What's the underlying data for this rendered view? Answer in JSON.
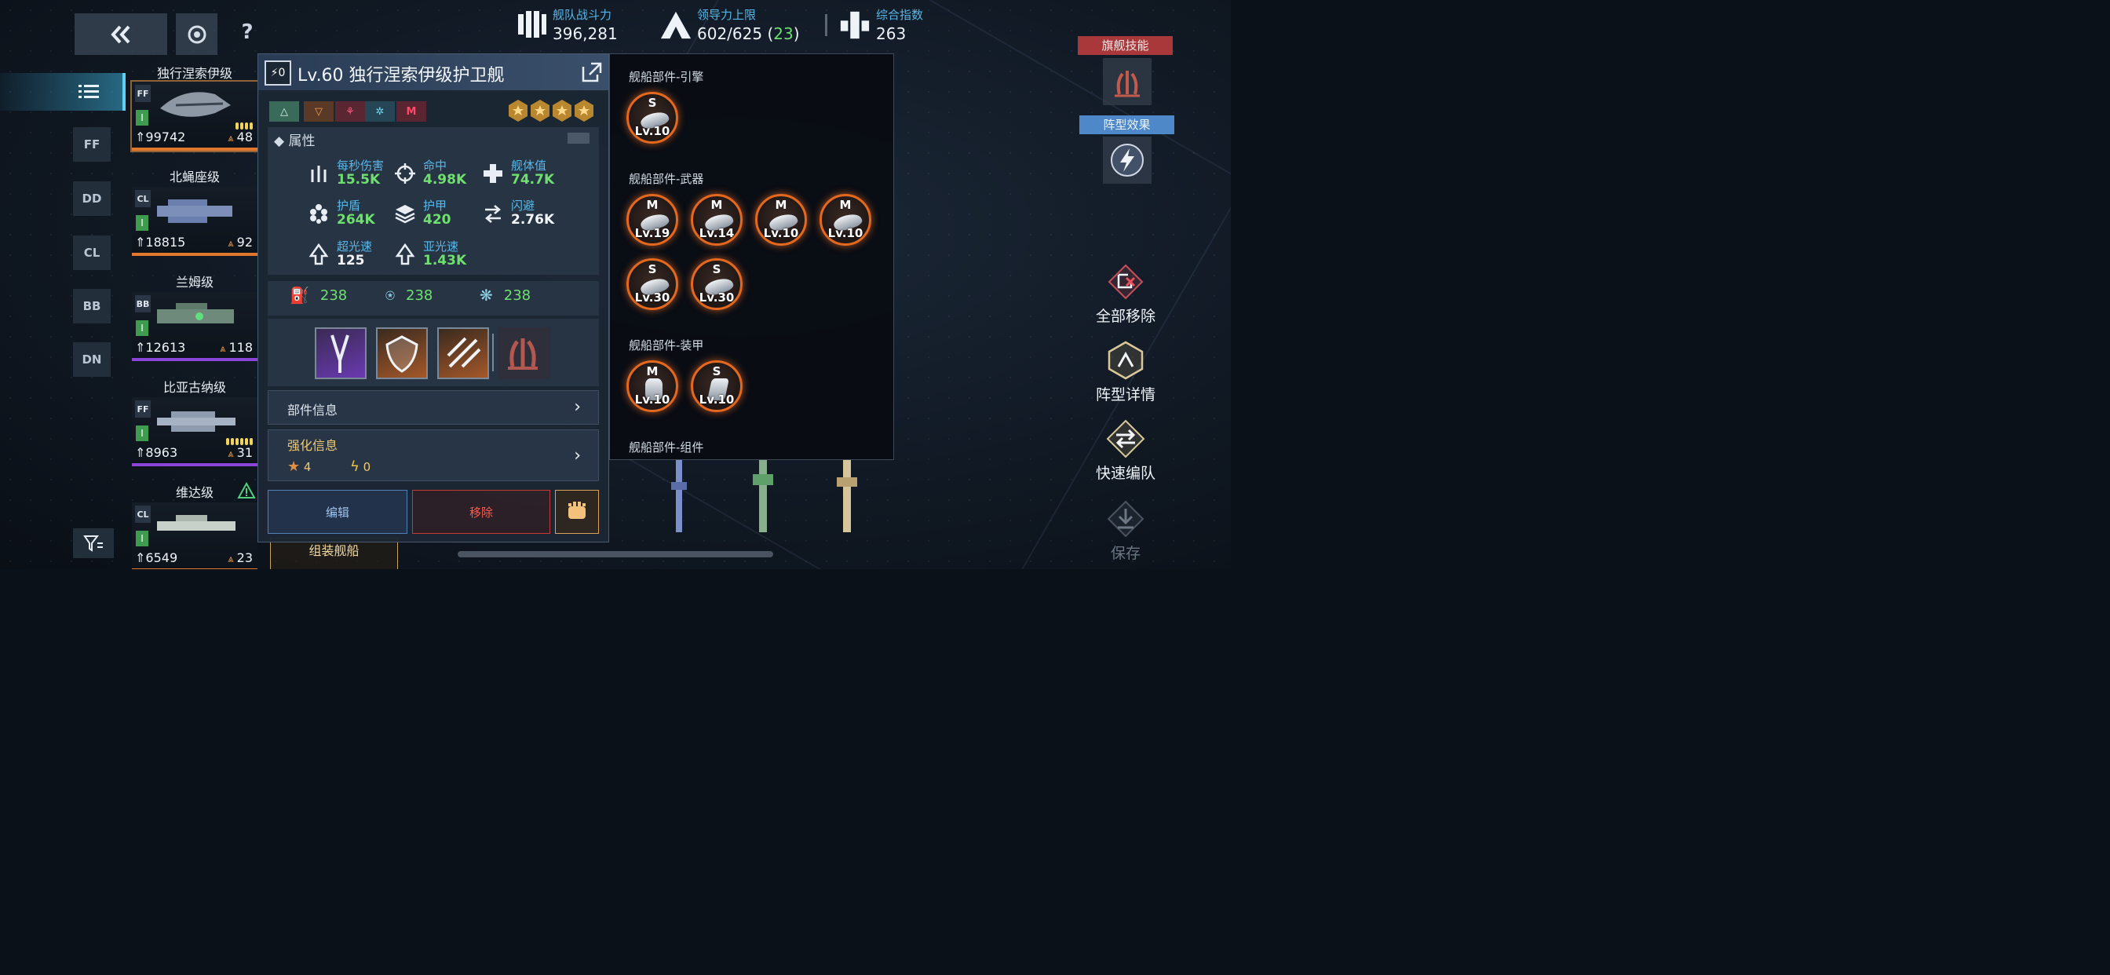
{
  "header": {
    "back_icon": "double-chevron-left",
    "help_label": "?",
    "stats": [
      {
        "label": "舰队战斗力",
        "value": "396,281"
      },
      {
        "label": "领导力上限",
        "value_prefix": "602/625 (",
        "value_highlight": "23",
        "value_suffix": ")"
      },
      {
        "label": "综合指数",
        "value": "263"
      }
    ]
  },
  "sidebar": {
    "type_tabs": [
      "FF",
      "DD",
      "CL",
      "BB",
      "DN"
    ]
  },
  "ships": [
    {
      "name": "独行涅索伊级",
      "class": "FF",
      "tier": "I",
      "power": "99742",
      "command": "48",
      "rarity": "orange",
      "pips": 4
    },
    {
      "name": "北蝇座级",
      "class": "CL",
      "tier": "I",
      "power": "18815",
      "command": "92",
      "rarity": "orange",
      "pips": 0
    },
    {
      "name": "兰姆级",
      "class": "BB",
      "tier": "I",
      "power": "12613",
      "command": "118",
      "rarity": "purple",
      "pips": 0
    },
    {
      "name": "比亚古纳级",
      "class": "FF",
      "tier": "I",
      "power": "8963",
      "command": "31",
      "rarity": "purple",
      "pips": 6
    },
    {
      "name": "维达级",
      "class": "CL",
      "tier": "I",
      "power": "6549",
      "command": "23",
      "rarity": "orange",
      "pips": 1
    }
  ],
  "detail": {
    "badge": "0",
    "title": "Lv.60 独行涅索伊级护卫舰",
    "traits": [
      "△",
      "▽",
      "⚘",
      "✲",
      "M"
    ],
    "stars": 4,
    "attributes_title": "属性",
    "attributes": [
      {
        "name": "每秒伤害",
        "value": "15.5K"
      },
      {
        "name": "命中",
        "value": "4.98K"
      },
      {
        "name": "舰体值",
        "value": "74.7K"
      },
      {
        "name": "护盾",
        "value": "264K"
      },
      {
        "name": "护甲",
        "value": "420"
      },
      {
        "name": "闪避",
        "value": "2.76K"
      },
      {
        "name": "超光速",
        "value": "125"
      },
      {
        "name": "亚光速",
        "value": "1.43K"
      }
    ],
    "resources": [
      "238",
      "238",
      "238"
    ],
    "parts_info": "部件信息",
    "enhance_info": "强化信息",
    "enhance_stars": "4",
    "enhance_bolts": "0",
    "edit_label": "编辑",
    "remove_label": "移除",
    "under_label": "组装舰船"
  },
  "parts": {
    "sections": [
      {
        "title": "舰船部件-引擎",
        "items": [
          {
            "grade": "S",
            "level": "Lv.10"
          }
        ]
      },
      {
        "title": "舰船部件-武器",
        "items": [
          {
            "grade": "M",
            "level": "Lv.19"
          },
          {
            "grade": "M",
            "level": "Lv.14"
          },
          {
            "grade": "M",
            "level": "Lv.10"
          },
          {
            "grade": "M",
            "level": "Lv.10"
          },
          {
            "grade": "S",
            "level": "Lv.30"
          },
          {
            "grade": "S",
            "level": "Lv.30"
          }
        ]
      },
      {
        "title": "舰船部件-装甲",
        "items": [
          {
            "grade": "M",
            "level": "Lv.10"
          },
          {
            "grade": "S",
            "level": "Lv.10"
          }
        ]
      },
      {
        "title": "舰船部件-组件",
        "items": []
      }
    ]
  },
  "right": {
    "flag_skill": "旗舰技能",
    "formation_effect": "阵型效果",
    "remove_all": "全部移除",
    "formation_detail": "阵型详情",
    "quick_form": "快速编队",
    "save": "保存"
  },
  "colors": {
    "accent_blue": "#58b7e8",
    "green_value": "#6fe06f",
    "orange_rarity": "#e0792e",
    "purple_rarity": "#8b45d8",
    "danger": "#ff5b50"
  }
}
